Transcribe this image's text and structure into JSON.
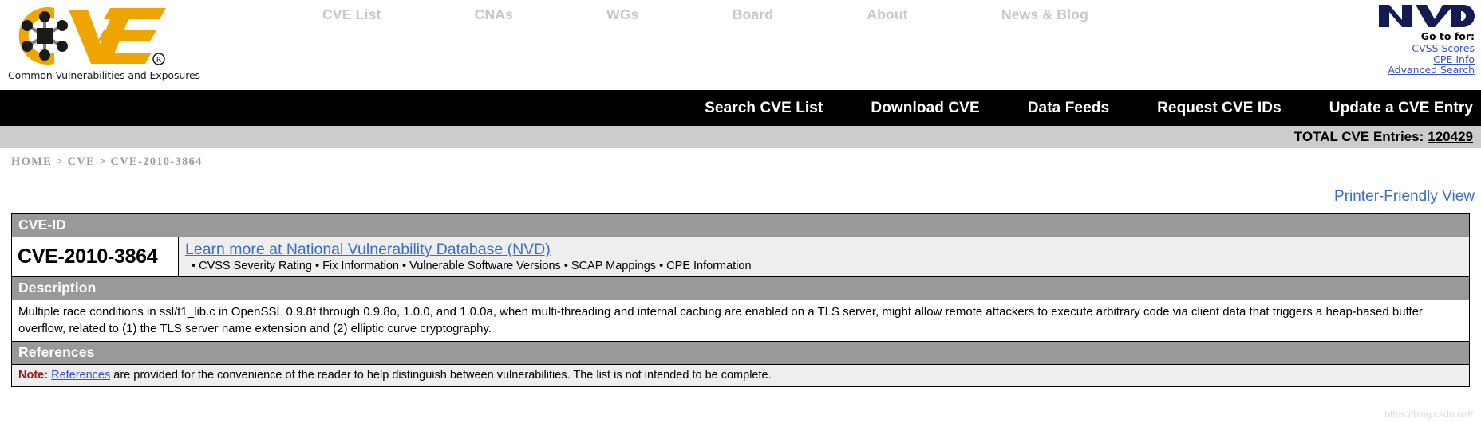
{
  "header": {
    "logo_tagline": "Common Vulnerabilities and Exposures",
    "logo_alt": "cve-logo",
    "nav": [
      {
        "label": "CVE List"
      },
      {
        "label": "CNAs"
      },
      {
        "label": "WGs"
      },
      {
        "label": "Board"
      },
      {
        "label": "About"
      },
      {
        "label": "News & Blog"
      }
    ],
    "nvd": {
      "logo_text": "NVD",
      "goto_label": "Go to for:",
      "links": [
        {
          "label": "CVSS Scores"
        },
        {
          "label": "CPE Info"
        },
        {
          "label": "Advanced Search"
        }
      ]
    }
  },
  "menu_bar": {
    "items": [
      {
        "label": "Search CVE List"
      },
      {
        "label": "Download CVE"
      },
      {
        "label": "Data Feeds"
      },
      {
        "label": "Request CVE IDs"
      },
      {
        "label": "Update a CVE Entry"
      }
    ]
  },
  "total_bar": {
    "label": "TOTAL CVE Entries:",
    "count": "120429"
  },
  "breadcrumb": {
    "home": "HOME",
    "sep1": ">",
    "cve": "CVE",
    "sep2": ">",
    "current": "CVE-2010-3864"
  },
  "printer_friendly": {
    "label": "Printer-Friendly View"
  },
  "detail": {
    "cveid_header": "CVE-ID",
    "cve_id": "CVE-2010-3864",
    "nvd_link": "Learn more at National Vulnerability Database (NVD)",
    "nvd_bullets": "• CVSS Severity Rating • Fix Information • Vulnerable Software Versions • SCAP Mappings • CPE Information",
    "description_header": "Description",
    "description": "Multiple race conditions in ssl/t1_lib.c in OpenSSL 0.9.8f through 0.9.8o, 1.0.0, and 1.0.0a, when multi-threading and internal caching are enabled on a TLS server, might allow remote attackers to execute arbitrary code via client data that triggers a heap-based buffer overflow, related to (1) the TLS server name extension and (2) elliptic curve cryptography.",
    "references_header": "References",
    "note_label": "Note:",
    "note_link": "References",
    "note_text": "are provided for the convenience of the reader to help distinguish between vulnerabilities. The list is not intended to be complete."
  },
  "watermark": {
    "text": "https://blog.csdn.net/"
  },
  "colors": {
    "accent_orange": "#f0a400",
    "nvd_navy": "#141a52",
    "link_blue": "#3a6fc4",
    "section_gray": "#999999",
    "bar_gray": "#cccccc",
    "note_red": "#9b1b1b"
  }
}
